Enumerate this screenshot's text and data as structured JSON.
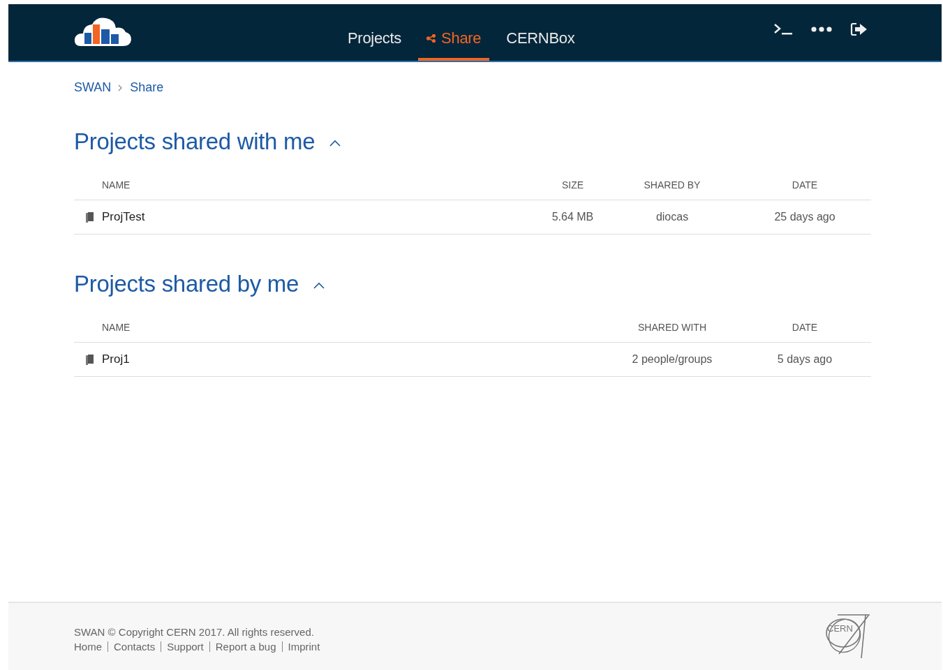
{
  "nav": {
    "tabs": [
      {
        "label": "Projects",
        "selected": false
      },
      {
        "label": "Share",
        "selected": true
      },
      {
        "label": "CERNBox",
        "selected": false
      }
    ]
  },
  "breadcrumb": [
    "SWAN",
    "Share"
  ],
  "sections": [
    {
      "title": "Projects shared with me",
      "expanded": true,
      "columns": [
        "NAME",
        "SIZE",
        "SHARED BY",
        "DATE"
      ],
      "rows": [
        {
          "cells": [
            "ProjTest",
            "5.64 MB",
            "diocas",
            "25 days ago"
          ]
        }
      ]
    },
    {
      "title": "Projects shared by me",
      "expanded": true,
      "columns": [
        "NAME",
        "SHARED WITH",
        "DATE"
      ],
      "rows": [
        {
          "cells": [
            "Proj1",
            "2 people/groups",
            "5 days ago"
          ]
        }
      ]
    }
  ],
  "footer": {
    "copyright": "SWAN © Copyright CERN 2017. All rights reserved.",
    "links": [
      "Home",
      "Contacts",
      "Support",
      "Report a bug",
      "Imprint"
    ],
    "logo_text": "CERN"
  }
}
